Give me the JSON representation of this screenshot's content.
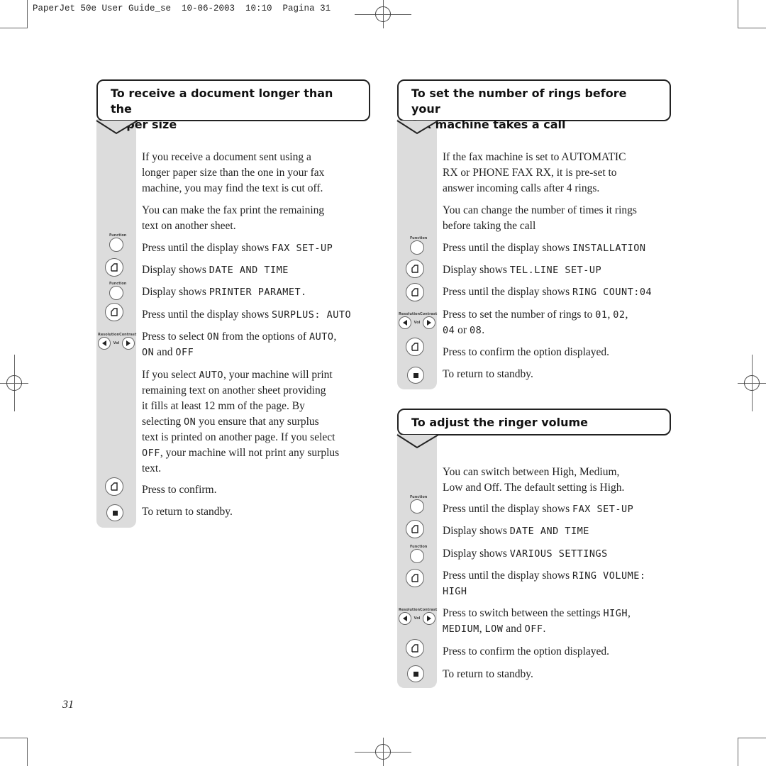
{
  "slug": "PaperJet 50e User Guide_se  10-06-2003  10:10  Pagina 31",
  "page_number": "31",
  "icons": {
    "function_label": "Function",
    "resolution_label": "Resolution",
    "contrast_label": "Contrast",
    "vol_label": "Vol"
  },
  "sections": {
    "receive_long": {
      "title_line1": "To receive a document longer than the",
      "title_line2": "paper size",
      "intro1": [
        "If you receive a document sent using a",
        "longer paper size than the one in your fax",
        "machine, you may find the text is cut off."
      ],
      "intro2": [
        "You can make the fax print the remaining",
        "text on another sheet."
      ],
      "steps": [
        {
          "icon": "function-button",
          "text": "Press until the display shows ",
          "lcd": "FAX SET-UP"
        },
        {
          "icon": "ok-button",
          "text": "Display shows ",
          "lcd": "DATE AND TIME"
        },
        {
          "icon": "function-button",
          "text": "Display shows ",
          "lcd": "PRINTER PARAMET."
        },
        {
          "icon": "ok-button",
          "text": "Press until the display shows ",
          "lcd": "SURPLUS: AUTO"
        },
        {
          "icon": "arrow-buttons",
          "text1": "Press to select ",
          "lcd1": "ON",
          "text2": " from the options of ",
          "lcd2": "AUTO",
          "text3": ",",
          "lcd3": "ON",
          "text4": " and ",
          "lcd4": "OFF"
        }
      ],
      "note": {
        "l1a": "If you select ",
        "l1lcd": "AUTO",
        "l1b": ", your machine will print",
        "l2": "remaining text on another sheet providing",
        "l3": "it fills at least 12 mm of the page. By",
        "l4a": "selecting ",
        "l4lcd": "ON",
        "l4b": " you ensure that any surplus",
        "l5": "text is printed on another page. If you select",
        "l6lcd": "OFF",
        "l6b": ", your machine will not print any surplus",
        "l7": "text."
      },
      "confirm": "Press to confirm.",
      "standby": "To return to standby."
    },
    "rings": {
      "title_line1": "To set the number of rings before your",
      "title_line2": "fax machine takes a call",
      "intro1": [
        "If the fax machine is set to AUTOMATIC",
        "RX or PHONE FAX RX, it is pre-set to",
        "answer incoming calls after 4 rings."
      ],
      "intro2": [
        "You can change the number of times it rings",
        "before taking the call"
      ],
      "steps": [
        {
          "icon": "function-button",
          "text": "Press until the display shows ",
          "lcd": "INSTALLATION"
        },
        {
          "icon": "ok-button",
          "text": "Display shows ",
          "lcd": "TEL.LINE SET-UP"
        },
        {
          "icon": "ok-button",
          "text": "Press until the display shows ",
          "lcd": "RING COUNT:04"
        }
      ],
      "arrow_step": {
        "text1": "Press to set the number of rings to ",
        "lcd1": "01",
        "sep1": ", ",
        "lcd2": "02",
        "sep2": ",",
        "lcd3": "04",
        "sep3": " or ",
        "lcd4": "08",
        "end": "."
      },
      "confirm": "Press to confirm the option displayed.",
      "standby": "To return to standby."
    },
    "ringer": {
      "title": "To adjust the ringer volume",
      "intro": [
        "You can switch between High, Medium,",
        "Low and Off. The default setting is High."
      ],
      "steps": [
        {
          "icon": "function-button",
          "text": "Press until the display shows ",
          "lcd": "FAX SET-UP"
        },
        {
          "icon": "ok-button",
          "text": "Display shows ",
          "lcd": "DATE AND TIME"
        },
        {
          "icon": "function-button",
          "text": "Display shows ",
          "lcd": "VARIOUS SETTINGS"
        },
        {
          "icon": "ok-button",
          "text": "Press until the display shows ",
          "lcd": "RING VOLUME:",
          "lcd_line2": "HIGH"
        }
      ],
      "arrow_step": {
        "text1": "Press to switch between the settings ",
        "lcd1": "HIGH",
        "sep1": ",",
        "lcd2": "MEDIUM",
        "sep2": ", ",
        "lcd3": "LOW",
        "sep3": " and ",
        "lcd4": "OFF",
        "end": "."
      },
      "confirm": "Press to confirm the option displayed.",
      "standby": "To return to standby."
    }
  }
}
